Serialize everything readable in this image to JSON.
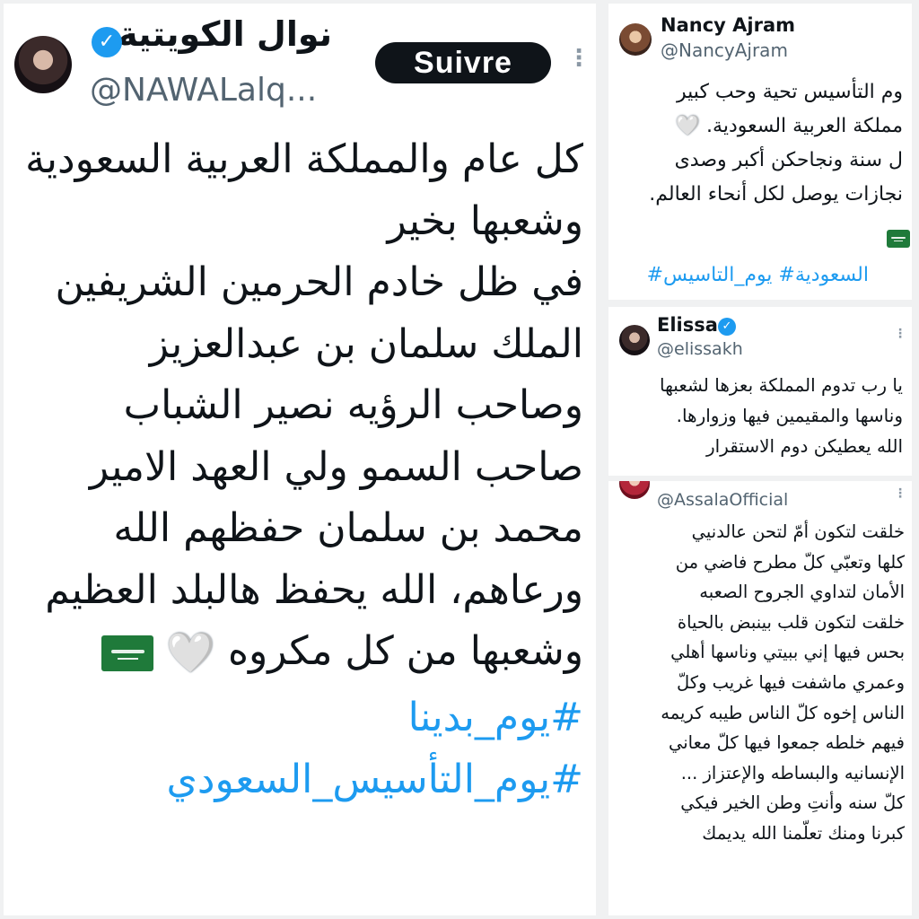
{
  "nawal": {
    "name": "نوال الكويتية",
    "handle": "@NAWALalq...",
    "verified_symbol": "✓",
    "follow_label": "Suivre",
    "more_symbol": "⋮",
    "lines": [
      "كل عام والمملكة العربية السعودية",
      "وشعبها بخير",
      "في ظل خادم الحرمين الشريفين",
      "الملك سلمان بن عبدالعزيز",
      "وصاحب الرؤيه نصير الشباب",
      "صاحب السمو ولي العهد الامير",
      "محمد بن سلمان حفظهم الله",
      "ورعاهم، الله يحفظ هالبلد العظيم",
      "وشعبها من كل مكروه"
    ],
    "heart": "🤍",
    "hashtags": [
      "#يوم_بدينا",
      "#يوم_التأسيس_السعودي"
    ]
  },
  "nancy": {
    "name": "Nancy Ajram",
    "handle": "@NancyAjram",
    "lines": [
      "وم التأسيس تحية وحب كبير",
      "مملكة العربية السعودية.",
      "ل سنة ونجاحكن أكبر وصدى",
      "نجازات يوصل لكل أنحاء العالم."
    ],
    "heart": "🤍",
    "hashtags": "السعودية# يوم_التاسيس#"
  },
  "elissa": {
    "name": "Elissa",
    "handle": "@elissakh",
    "verified_symbol": "✓",
    "more_symbol": "⋮",
    "lines": [
      "يا رب تدوم المملكة بعزها لشعبها",
      "وناسها والمقيمين فيها وزوارها.",
      "الله يعطيكن دوم الاستقرار"
    ]
  },
  "assala": {
    "handle": "@AssalaOfficial",
    "more_symbol": "⋮",
    "lines": [
      "خلقت لتكون أمّ لتحن عالدنيي",
      "كلها وتعبّي كلّ مطرح فاضي من",
      "الأمان لتداوي الجروح الصعبه",
      "خلقت لتكون قلب بينبض بالحياة",
      "بحس فيها إني ببيتي وناسها أهلي",
      "وعمري ماشفت فيها غريب وكلّ",
      "الناس إخوه كلّ الناس طيبه كريمه",
      "فيهم خلطه جمعوا فيها كلّ معاني",
      "الإنسانيه والبساطه والإعتزاز ...",
      "كلّ سنه وأنتِ وطن الخير فيكي",
      "كبرنا ومنك تعلّمنا الله يديمك"
    ]
  }
}
